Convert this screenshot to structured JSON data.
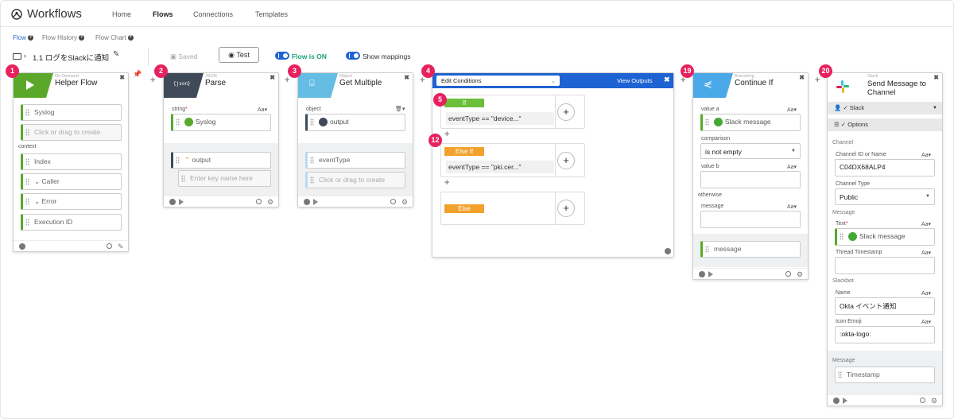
{
  "app": {
    "title": "Workflows"
  },
  "nav": [
    "Home",
    "Flows",
    "Connections",
    "Templates"
  ],
  "subnav": [
    "Flow",
    "Flow History",
    "Flow Chart"
  ],
  "toolbar": {
    "flow_name": "1.1 ログをSlackに通知",
    "saved": "Saved",
    "test": "Test",
    "flow_on": "Flow is ON",
    "show_mappings": "Show mappings"
  },
  "cards": {
    "c1": {
      "num": "1",
      "sub": "On-Demand",
      "title": "Helper Flow",
      "f1": "Syslog",
      "f2": "Click or drag to create",
      "ctx": "context",
      "f3": "Index",
      "f4": "Caller",
      "f5": "Error",
      "f6": "Execution ID"
    },
    "c2": {
      "num": "2",
      "sub": "JSON",
      "title": "Parse",
      "lbl": "string",
      "aa": "Aa",
      "in1": "Syslog",
      "out1": "output",
      "out2": "Enter key name here"
    },
    "c3": {
      "num": "3",
      "sub": "Object",
      "title": "Get Multiple",
      "lbl": "object",
      "in1": "output",
      "out1": "eventType",
      "out2": "Click or drag to create"
    },
    "c4": {
      "num": "4",
      "dropdown": "Edit Conditions",
      "view": "View Outputs",
      "n5": "5",
      "n12": "12",
      "if": "If",
      "if_expr": "eventType == \"device...\"",
      "elseif": "Else If",
      "elseif_expr": "eventType == \"pki.cer...\"",
      "else": "Else"
    },
    "c19": {
      "num": "19",
      "sub": "Branching",
      "title": "Continue If",
      "lbl_a": "value a",
      "val_a": "Slack message",
      "lbl_cmp": "comparison",
      "cmp": "is not empty",
      "lbl_b": "value b",
      "otherwise": "otherwise",
      "lbl_msg": "message",
      "out": "message"
    },
    "c20": {
      "num": "20",
      "sub": "Slack",
      "title": "Send Message to Channel",
      "conn": "Slack",
      "options": "Options",
      "sec_channel": "Channel",
      "lbl_cid": "Channel ID or Name",
      "cid": "C04DX68ALP4",
      "lbl_ctype": "Channel Type",
      "ctype": "Public",
      "sec_message": "Message",
      "lbl_text": "Text",
      "text": "Slack message",
      "lbl_thread": "Thread Timestamp",
      "sec_slackbot": "Slackbot",
      "lbl_name": "Name",
      "name": "Okta イベント通知",
      "lbl_emoji": "Icon Emoji",
      "emoji": ":okta-logo:",
      "sec_out": "Message",
      "out": "Timestamp"
    }
  }
}
